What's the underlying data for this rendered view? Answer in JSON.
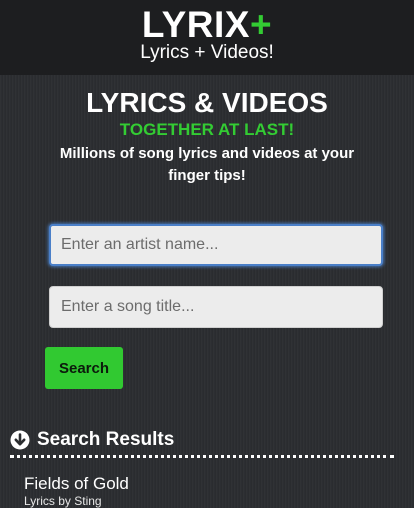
{
  "header": {
    "logo_text": "LYRIX",
    "logo_plus": "+",
    "tagline": "Lyrics + Videos!"
  },
  "hero": {
    "title": "LYRICS & VIDEOS",
    "subtitle": "TOGETHER AT LAST!",
    "description": "Millions of song lyrics and videos at your finger tips!"
  },
  "search": {
    "artist_placeholder": "Enter an artist name...",
    "artist_value": "",
    "song_placeholder": "Enter a song title...",
    "song_value": "",
    "button_label": "Search"
  },
  "results": {
    "heading": "Search Results",
    "heading_icon": "arrow-circle-down-icon",
    "items": [
      {
        "title": "Fields of Gold",
        "subtitle": "Lyrics by Sting"
      }
    ]
  },
  "colors": {
    "accent": "#33cc33",
    "background": "#2b2d30",
    "header_background": "#1d1e20",
    "focus_border": "#4a7fc8"
  }
}
